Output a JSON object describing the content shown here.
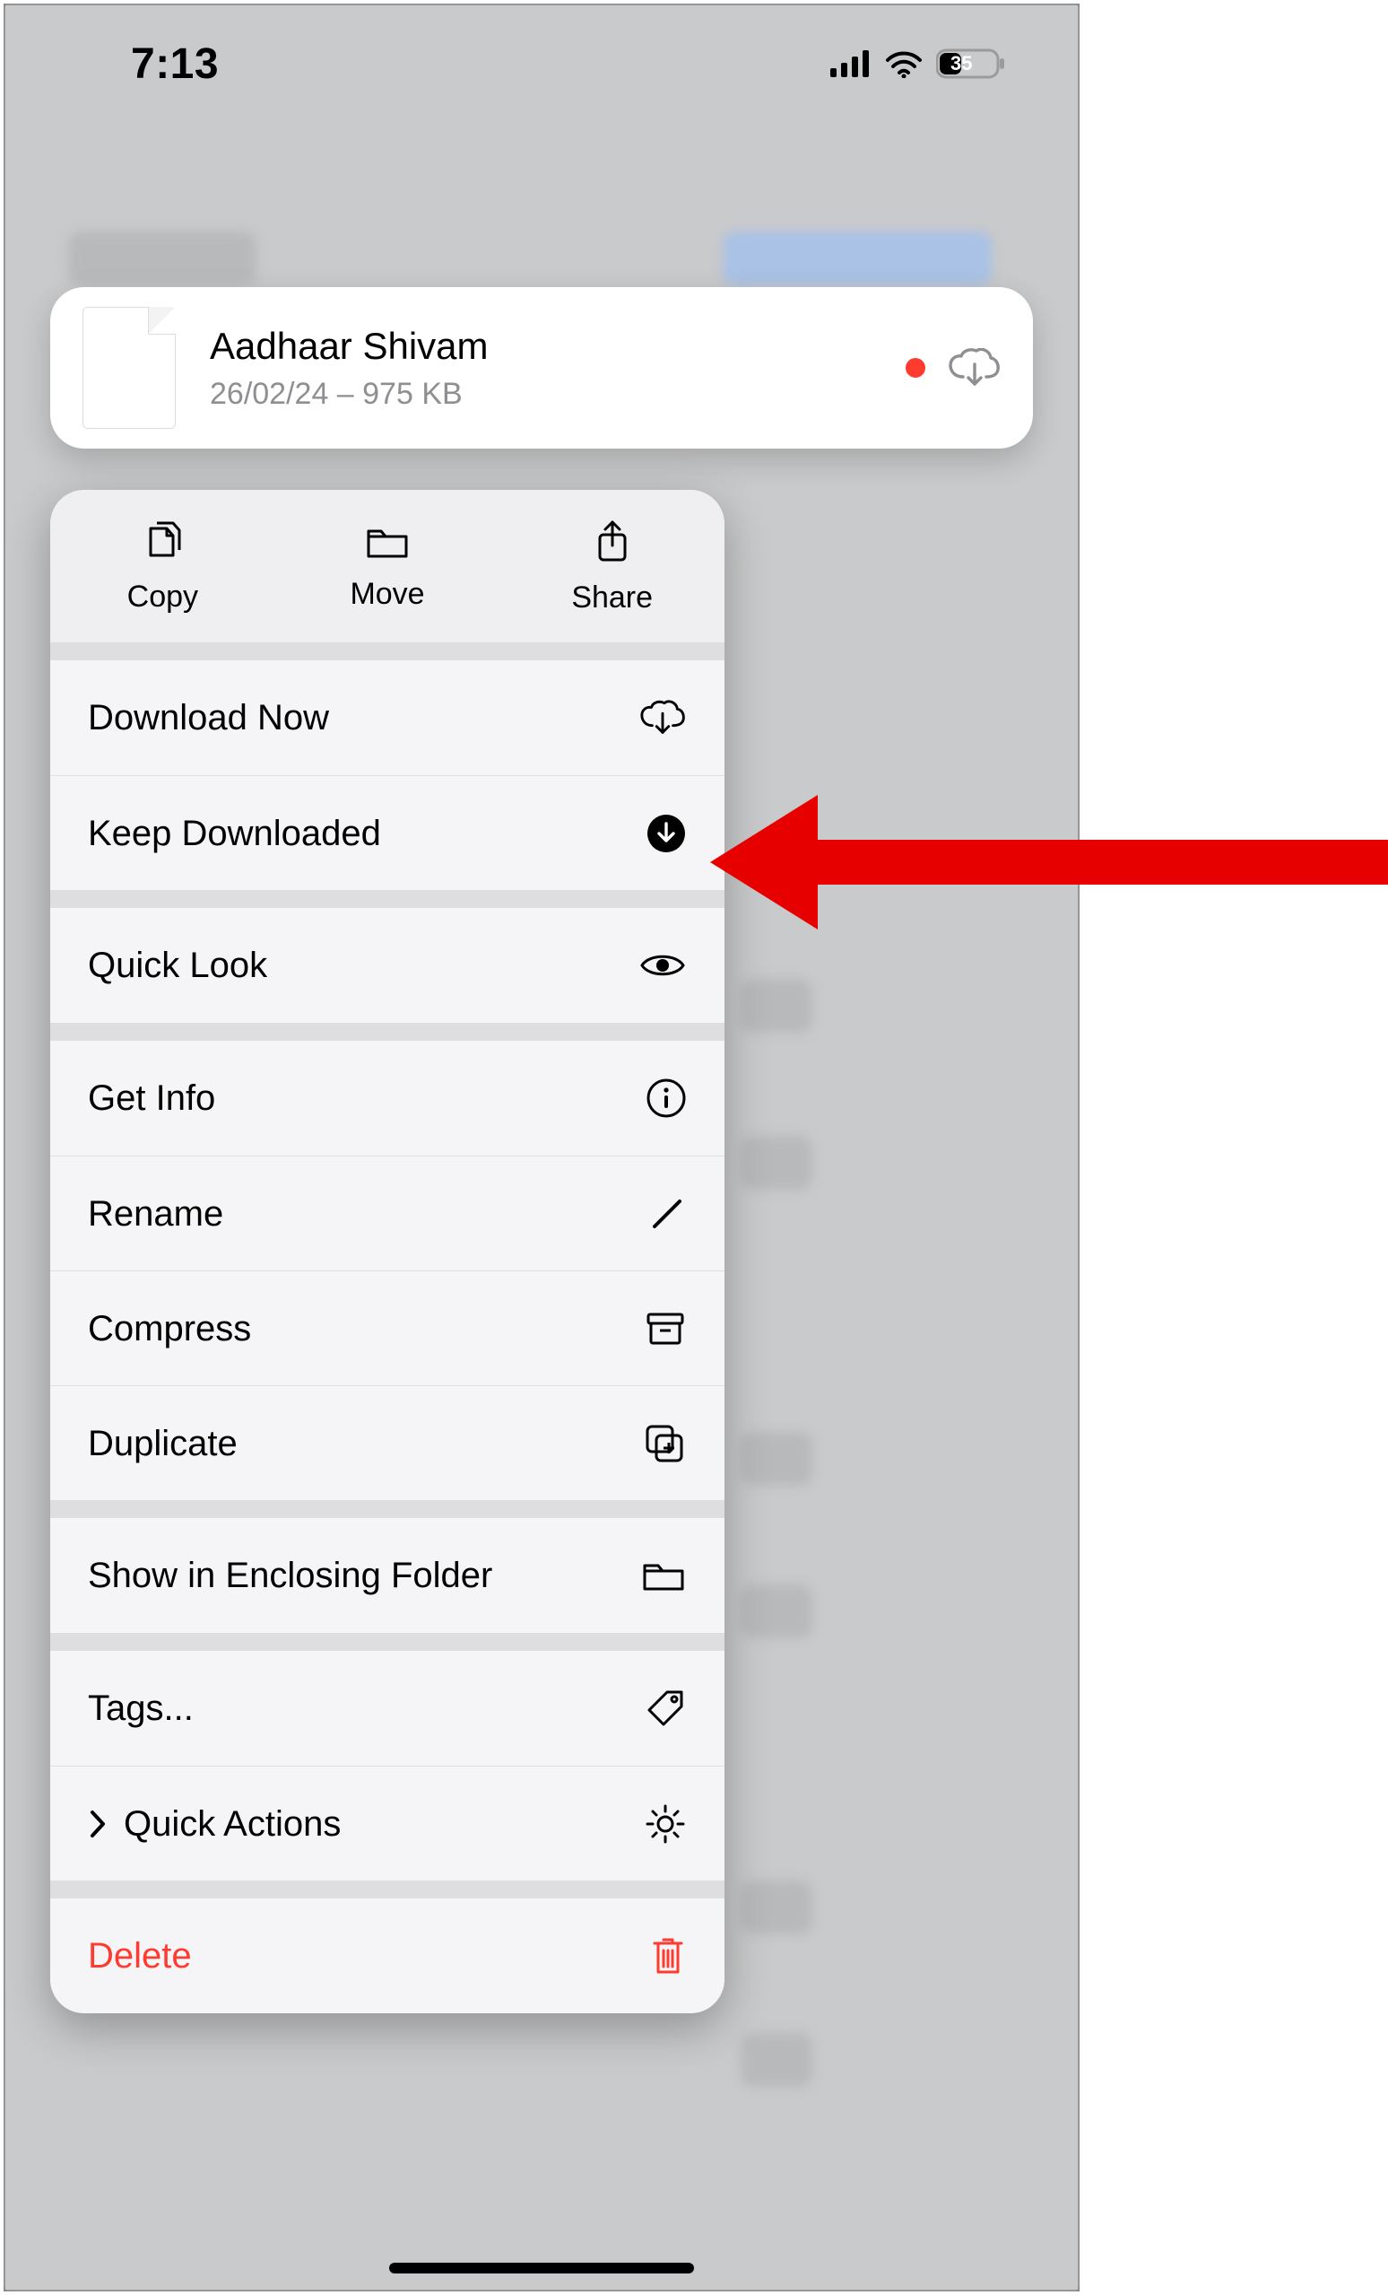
{
  "status": {
    "time": "7:13",
    "battery_pct": "35"
  },
  "file": {
    "name": "Aadhaar Shivam",
    "subtitle": "26/02/24 – 975 KB"
  },
  "menu_top": {
    "copy": "Copy",
    "move": "Move",
    "share": "Share"
  },
  "menu": {
    "download_now": "Download Now",
    "keep_downloaded": "Keep Downloaded",
    "quick_look": "Quick Look",
    "get_info": "Get Info",
    "rename": "Rename",
    "compress": "Compress",
    "duplicate": "Duplicate",
    "show_in_enclosing_folder": "Show in Enclosing Folder",
    "tags": "Tags...",
    "quick_actions": "Quick Actions",
    "delete": "Delete"
  }
}
